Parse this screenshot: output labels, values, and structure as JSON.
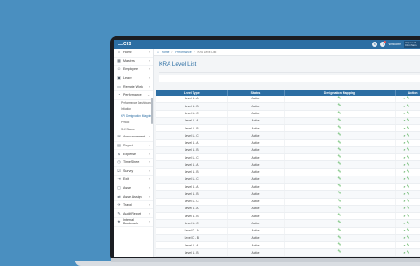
{
  "app": {
    "logo": "CIS",
    "user_label": "Welcome",
    "header_block": "Unique Ltd Client Name"
  },
  "breadcrumb": [
    "Home",
    "Performance",
    "KRA Level List"
  ],
  "page": {
    "title": "KRA Level List"
  },
  "sidebar": {
    "items": [
      {
        "label": "Home",
        "icon": "home-icon",
        "glyph": "⌂",
        "chevron": "›"
      },
      {
        "label": "Masters",
        "icon": "grid-icon",
        "glyph": "▦",
        "chevron": "›"
      },
      {
        "label": "Employee",
        "icon": "users-icon",
        "glyph": "☺",
        "chevron": "›"
      },
      {
        "label": "Leave",
        "icon": "calendar-icon",
        "glyph": "▣",
        "chevron": "›"
      },
      {
        "label": "Remote Work",
        "icon": "laptop-icon",
        "glyph": "▭",
        "chevron": "›"
      },
      {
        "label": "Performance",
        "icon": "chart-icon",
        "glyph": "◔",
        "chevron": "⌄"
      }
    ],
    "subitems": [
      {
        "label": "Performance Dashboard",
        "active": false
      },
      {
        "label": "Initiation",
        "active": false
      },
      {
        "label": "KPI Designation Mapping",
        "active": true
      },
      {
        "label": "Period",
        "active": false
      },
      {
        "label": "Self Status",
        "active": false
      }
    ],
    "items2": [
      {
        "label": "Announcement",
        "icon": "megaphone-icon",
        "glyph": "✉",
        "chevron": "›"
      },
      {
        "label": "Report",
        "icon": "report-icon",
        "glyph": "▤",
        "chevron": "›"
      },
      {
        "label": "Expense",
        "icon": "expense-icon",
        "glyph": "$",
        "chevron": "›"
      },
      {
        "label": "Time Sheet",
        "icon": "clock-icon",
        "glyph": "◷",
        "chevron": "›"
      },
      {
        "label": "Survey",
        "icon": "survey-icon",
        "glyph": "☑",
        "chevron": "›"
      },
      {
        "label": "Exit",
        "icon": "exit-icon",
        "glyph": "⇥",
        "chevron": "›"
      },
      {
        "label": "Asset",
        "icon": "asset-icon",
        "glyph": "▢",
        "chevron": "›"
      },
      {
        "label": "Asset Assign",
        "icon": "assign-icon",
        "glyph": "⇄",
        "chevron": "›"
      },
      {
        "label": "Travel",
        "icon": "travel-icon",
        "glyph": "✈",
        "chevron": "›"
      },
      {
        "label": "Audit Report",
        "icon": "audit-icon",
        "glyph": "✎",
        "chevron": "›"
      },
      {
        "label": "Internal Bookmark",
        "icon": "bookmark-icon",
        "glyph": "★",
        "chevron": "›"
      }
    ]
  },
  "table": {
    "headers": [
      "Level Type",
      "Status",
      "Designation Mapping",
      "Action"
    ],
    "rows": [
      {
        "level": "Level L - A",
        "status": "Active"
      },
      {
        "level": "Level L - B",
        "status": "Active"
      },
      {
        "level": "Level L - C",
        "status": "Active"
      },
      {
        "level": "Level L - A",
        "status": "Active"
      },
      {
        "level": "Level L - B",
        "status": "Active"
      },
      {
        "level": "Level L - C",
        "status": "Active"
      },
      {
        "level": "Level L - A",
        "status": "Active"
      },
      {
        "level": "Level L - B",
        "status": "Active"
      },
      {
        "level": "Level L - C",
        "status": "Active"
      },
      {
        "level": "Level L - A",
        "status": "Active"
      },
      {
        "level": "Level L - B",
        "status": "Active"
      },
      {
        "level": "Level L - C",
        "status": "Active"
      },
      {
        "level": "Level L - A",
        "status": "Active"
      },
      {
        "level": "Level L - B",
        "status": "Active"
      },
      {
        "level": "Level L - C",
        "status": "Active"
      },
      {
        "level": "Level L - A",
        "status": "Active"
      },
      {
        "level": "Level L - B",
        "status": "Active"
      },
      {
        "level": "Level L - C",
        "status": "Active"
      },
      {
        "level": "Level D - A",
        "status": "Active"
      },
      {
        "level": "Level D - B",
        "status": "Active"
      },
      {
        "level": "Level L - A",
        "status": "Active"
      },
      {
        "level": "Level L - B",
        "status": "Active"
      },
      {
        "level": "Level L - C",
        "status": "Active"
      }
    ]
  },
  "colors": {
    "background": "#4a8fc0",
    "header": "#2c6ea3",
    "accent_icon": "#4caf50"
  }
}
